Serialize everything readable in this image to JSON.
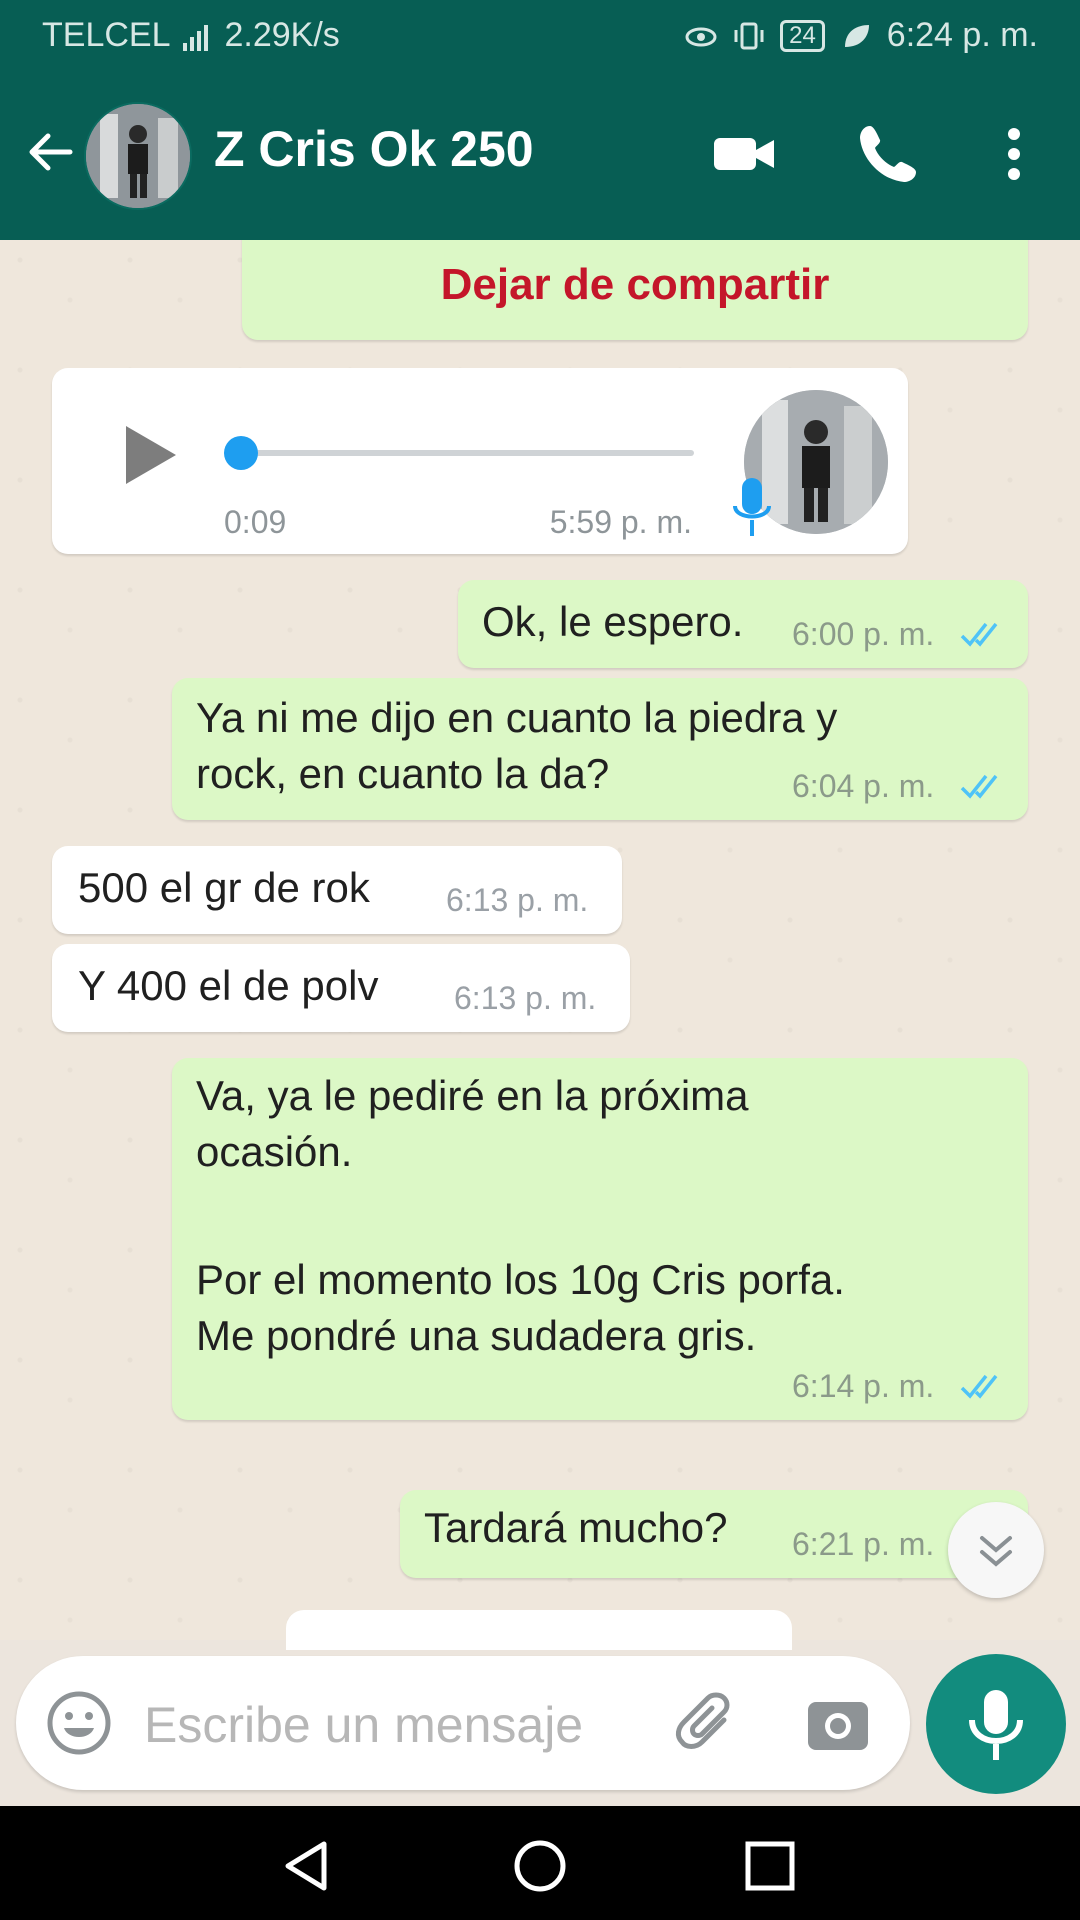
{
  "status_bar": {
    "carrier": "TELCEL",
    "speed": "2.29K/s",
    "battery": "24",
    "time": "6:24 p. m."
  },
  "header": {
    "contact_name": "Z Cris Ok 250"
  },
  "messages": {
    "share_action": "Dejar de compartir",
    "voice": {
      "duration": "0:09",
      "time": "5:59 p. m.",
      "progress": 0.0
    },
    "m1": {
      "text": "Ok, le espero.",
      "time": "6:00 p. m."
    },
    "m2": {
      "text_l1": "Ya ni me dijo en cuanto la piedra y",
      "text_l2": "rock, en cuanto la da?",
      "time": "6:04 p. m."
    },
    "m3": {
      "text": "500 el gr de rok",
      "time": "6:13 p. m."
    },
    "m4": {
      "text": "Y 400 el de polv",
      "time": "6:13 p. m."
    },
    "m5": {
      "text_l1": "Va, ya le pediré en la próxima",
      "text_l2": "ocasión.",
      "text_l3": "Por el momento los 10g Cris porfa.",
      "text_l4": "Me pondré una sudadera gris.",
      "time": "6:14 p. m."
    },
    "m6": {
      "text": "Tardará mucho?",
      "time": "6:21 p. m."
    }
  },
  "input": {
    "placeholder": "Escribe un mensaje"
  },
  "colors": {
    "header": "#075e54",
    "outgoing": "#dcf8c6",
    "incoming": "#ffffff",
    "accent": "#128c7e",
    "tick_read": "#4fc3f7",
    "share_red": "#c4162a"
  }
}
